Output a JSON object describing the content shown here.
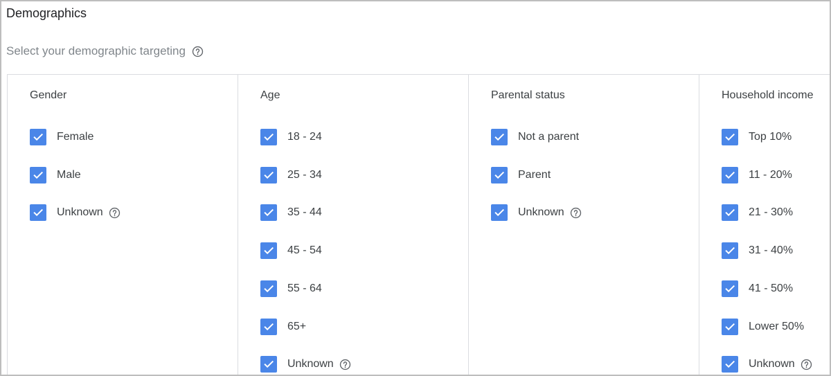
{
  "title": "Demographics",
  "subtitle": "Select your demographic targeting",
  "icons": {
    "help": "help-circle-icon",
    "check": "checkmark-icon"
  },
  "colors": {
    "checkbox": "#4a86e8",
    "divider": "#dadce0",
    "text": "#3c4043",
    "muted": "#80868b"
  },
  "columns": [
    {
      "title": "Gender",
      "options": [
        {
          "label": "Female",
          "checked": true,
          "help": false
        },
        {
          "label": "Male",
          "checked": true,
          "help": false
        },
        {
          "label": "Unknown",
          "checked": true,
          "help": true
        }
      ]
    },
    {
      "title": "Age",
      "options": [
        {
          "label": "18 - 24",
          "checked": true,
          "help": false
        },
        {
          "label": "25 - 34",
          "checked": true,
          "help": false
        },
        {
          "label": "35 - 44",
          "checked": true,
          "help": false
        },
        {
          "label": "45 - 54",
          "checked": true,
          "help": false
        },
        {
          "label": "55 - 64",
          "checked": true,
          "help": false
        },
        {
          "label": "65+",
          "checked": true,
          "help": false
        },
        {
          "label": "Unknown",
          "checked": true,
          "help": true
        }
      ]
    },
    {
      "title": "Parental status",
      "options": [
        {
          "label": "Not a parent",
          "checked": true,
          "help": false
        },
        {
          "label": "Parent",
          "checked": true,
          "help": false
        },
        {
          "label": "Unknown",
          "checked": true,
          "help": true
        }
      ]
    },
    {
      "title": "Household income",
      "options": [
        {
          "label": "Top 10%",
          "checked": true,
          "help": false
        },
        {
          "label": "11 - 20%",
          "checked": true,
          "help": false
        },
        {
          "label": "21 - 30%",
          "checked": true,
          "help": false
        },
        {
          "label": "31 - 40%",
          "checked": true,
          "help": false
        },
        {
          "label": "41 - 50%",
          "checked": true,
          "help": false
        },
        {
          "label": "Lower 50%",
          "checked": true,
          "help": false
        },
        {
          "label": "Unknown",
          "checked": true,
          "help": true
        }
      ]
    }
  ]
}
